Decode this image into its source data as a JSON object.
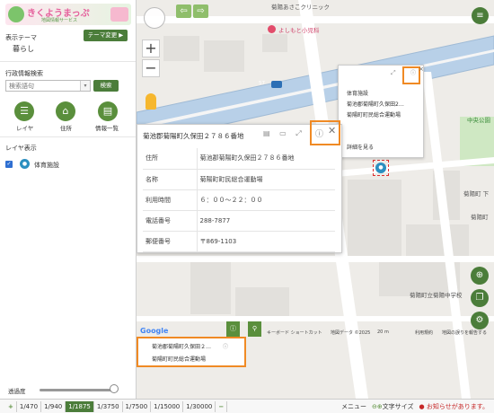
{
  "app": {
    "logo_text": "きくようまっぷ",
    "logo_subtext": "地図情報サービス"
  },
  "sidebar": {
    "theme_label": "表示テーマ",
    "theme_value": "暮らし",
    "theme_change_label": "テーマ変更 ▶",
    "search_label": "行政情報検索",
    "search_placeholder": "検索語句",
    "search_button": "検索",
    "nav": [
      {
        "label": "レイヤ",
        "icon": "list-icon"
      },
      {
        "label": "住所",
        "icon": "home-icon"
      },
      {
        "label": "情報一覧",
        "icon": "table-icon"
      }
    ],
    "layer_title": "レイヤ表示",
    "layer_item": "体育施設",
    "opacity_label": "透過度"
  },
  "map": {
    "clinic_label": "菊陽あさこクリニック",
    "clinic2_label": "よしもと小児科",
    "route_number": "57",
    "park_label": "中央公園",
    "town_label": "菊陽町 下",
    "school_label": "菊陽町立菊陽中学校",
    "place_label": "菊陽町",
    "attribution": {
      "google": "Google",
      "shortcuts": "キーボード ショートカット",
      "mapdata": "地図データ ©2025",
      "scale": "20 m",
      "terms": "利用規約",
      "report": "地図の誤りを報告する"
    }
  },
  "popup_small": {
    "line1": "体育施設",
    "line2": "菊池郡菊陽町久保田2…",
    "line3": "菊陽町町民総合運動場",
    "link": "詳細を見る"
  },
  "popup_main": {
    "title": "菊池郡菊陽町久保田２７８６番地",
    "rows": [
      {
        "key": "住所",
        "value": "菊池郡菊陽町久保田２７８６番地"
      },
      {
        "key": "名称",
        "value": "菊陽町町民総合運動場"
      },
      {
        "key": "利用時間",
        "value": "６：００〜２２：００"
      },
      {
        "key": "電話番号",
        "value": "288-7877"
      },
      {
        "key": "郵便番号",
        "value": "〒869-1103"
      }
    ]
  },
  "bottom_popup": {
    "line1": "菊池郡菊陽町久保田２…",
    "line2": "菊陽町町民総合運動場"
  },
  "statusbar": {
    "scales": [
      "1/470",
      "1/940",
      "1/1875",
      "1/3750",
      "1/7500",
      "1/15000",
      "1/30000"
    ],
    "active_scale": "1/1875",
    "menu_label": "メニュー",
    "text_size_label": "文字サイズ",
    "notice": "お知らせがあります。"
  },
  "colors": {
    "accent": "#4b7d3a",
    "highlight": "#f08a24",
    "notice": "#c62828"
  }
}
